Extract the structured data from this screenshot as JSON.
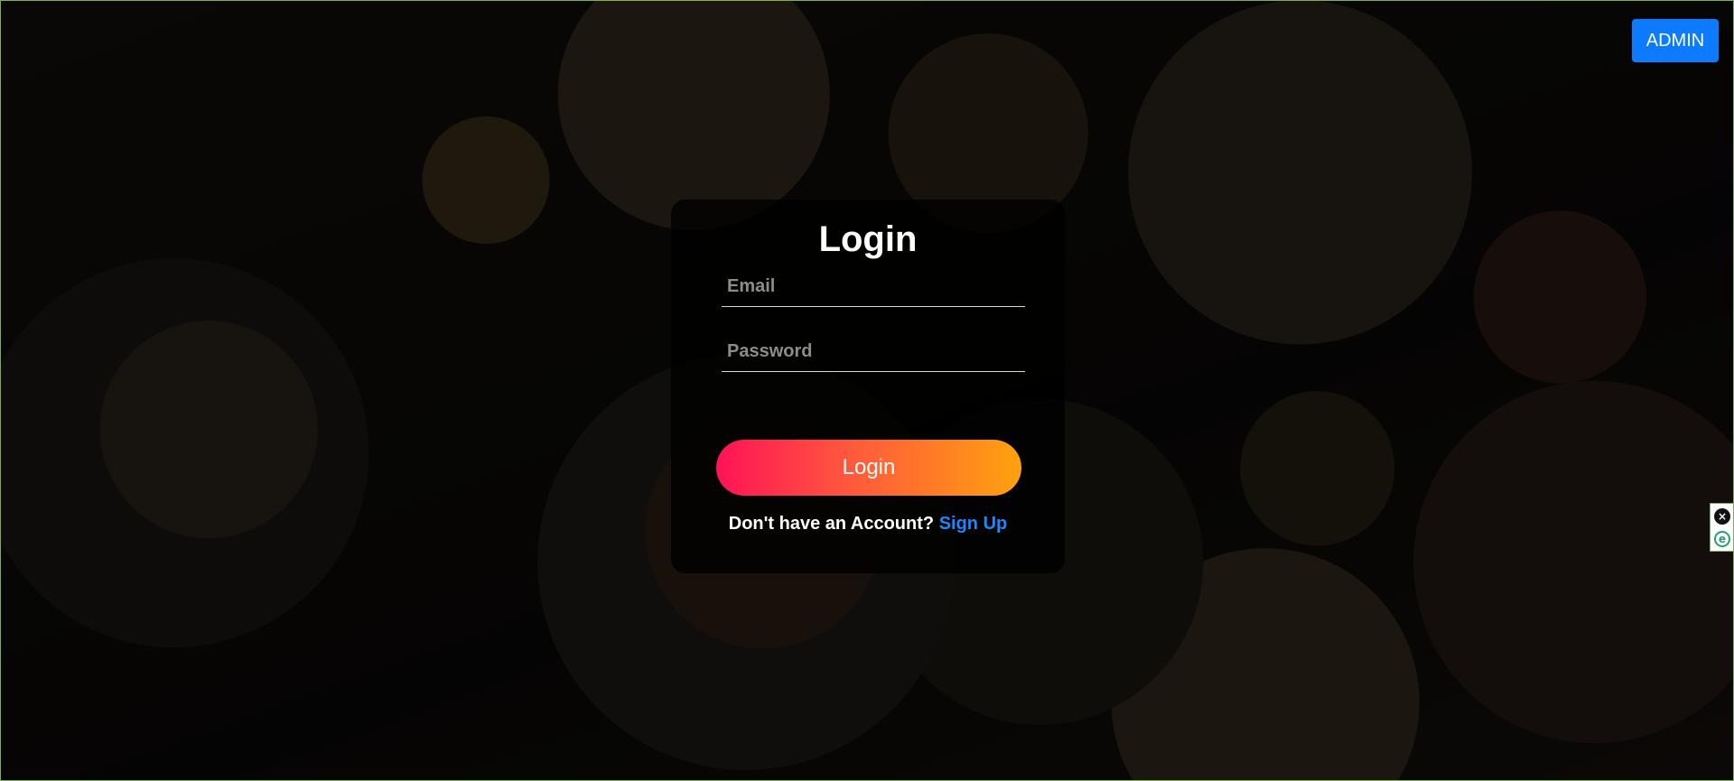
{
  "header": {
    "admin_label": "ADMIN"
  },
  "login_card": {
    "title": "Login",
    "email_placeholder": "Email",
    "password_placeholder": "Password",
    "email_value": "",
    "password_value": "",
    "submit_label": "Login",
    "signup_prompt": "Don't have an Account?",
    "signup_link": "Sign Up"
  },
  "side_widget": {
    "close_icon": "close-icon",
    "extension_icon": "e-icon"
  },
  "colors": {
    "admin_button": "#0d7bff",
    "gradient_start": "#ff1358",
    "gradient_end": "#ffa20e",
    "link": "#1e86ff"
  }
}
